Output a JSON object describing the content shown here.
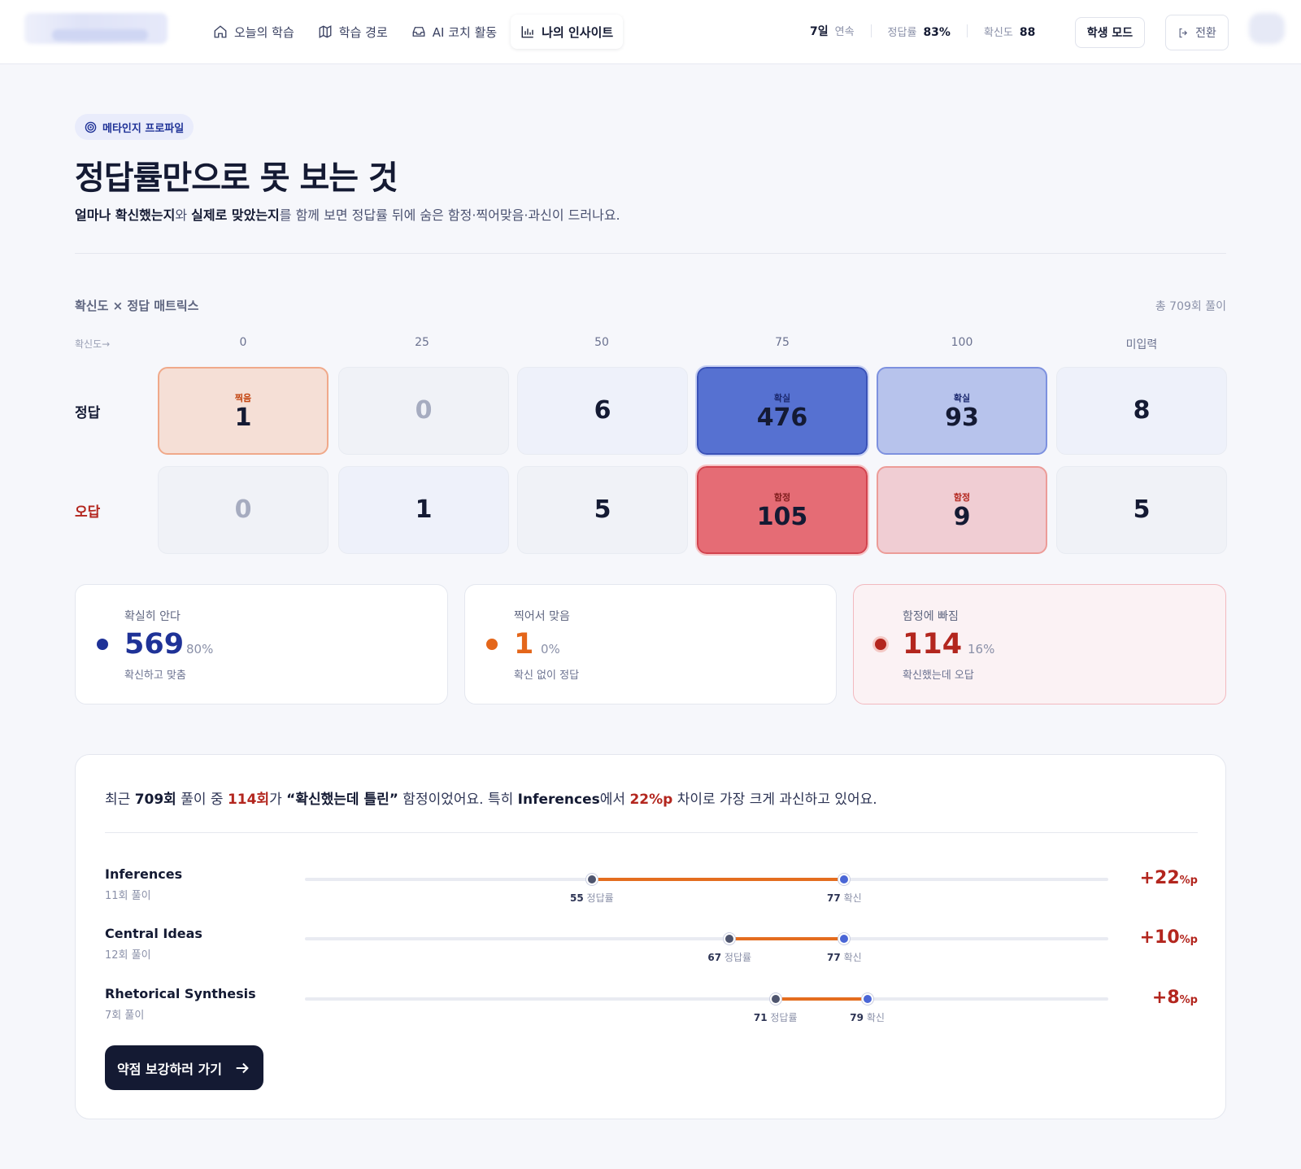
{
  "nav": {
    "items": [
      {
        "label": "오늘의 학습",
        "icon": "home-icon"
      },
      {
        "label": "학습 경로",
        "icon": "map-icon"
      },
      {
        "label": "AI 코치 활동",
        "icon": "inbox-icon"
      },
      {
        "label": "나의 인사이트",
        "icon": "bar-chart-icon",
        "active": true
      }
    ]
  },
  "stats": {
    "streak_value": "7일",
    "streak_label": "연속",
    "accuracy_label": "정답률",
    "accuracy_value": "83%",
    "confidence_label": "확신도",
    "confidence_value": "88"
  },
  "header": {
    "mode_button": "학생 모드",
    "switch_button": "전환",
    "chip": "메타인지 프로파일",
    "title": "정답률만으로 못 보는 것",
    "sub_b1": "얼마나 확신했는지",
    "sub_t1": "와 ",
    "sub_b2": "실제로 맞았는지",
    "sub_t2": "를 함께 보면 정답률 뒤에 숨은 함정·찍어맞음·과신이 드러나요."
  },
  "matrix": {
    "title": "확신도 × 정답 매트릭스",
    "total": "총 709회 풀이",
    "axis": "확신도→",
    "columns": [
      "0",
      "25",
      "50",
      "75",
      "100",
      "미입력"
    ],
    "rows": [
      {
        "label": "정답",
        "cells": [
          {
            "value": "1",
            "tag": "찍음",
            "style": "guess"
          },
          {
            "value": "0",
            "tag": "",
            "style": "zero"
          },
          {
            "value": "6",
            "tag": "",
            "style": "light"
          },
          {
            "value": "476",
            "tag": "확실",
            "style": "sure-strong"
          },
          {
            "value": "93",
            "tag": "확실",
            "style": "sure-light"
          },
          {
            "value": "8",
            "tag": "",
            "style": "light"
          }
        ]
      },
      {
        "label": "오답",
        "cells": [
          {
            "value": "0",
            "tag": "",
            "style": "zero"
          },
          {
            "value": "1",
            "tag": "",
            "style": "light"
          },
          {
            "value": "5",
            "tag": "",
            "style": "plain"
          },
          {
            "value": "105",
            "tag": "함정",
            "style": "trap-strong"
          },
          {
            "value": "9",
            "tag": "함정",
            "style": "trap-light"
          },
          {
            "value": "5",
            "tag": "",
            "style": "plain"
          }
        ]
      }
    ]
  },
  "summary": [
    {
      "label": "확실히 안다",
      "value": "569",
      "pct": "80%",
      "desc": "확신하고 맞춤",
      "color": "#1f3297"
    },
    {
      "label": "찍어서 맞음",
      "value": "1",
      "pct": "0%",
      "desc": "확신 없이 정답",
      "color": "#e4661a"
    },
    {
      "label": "함정에 빠짐",
      "value": "114",
      "pct": "16%",
      "desc": "확신했는데 오답",
      "color": "#b3261e"
    }
  ],
  "insight": {
    "t1": "최근 ",
    "b1": "709회",
    "t2": " 풀이 중 ",
    "r1": "114회",
    "t3": "가 ",
    "b2": "“확신했는데 틀린”",
    "t4": " 함정이었어요. 특히 ",
    "b3": "Inferences",
    "t5": "에서 ",
    "r2": "22%p",
    "t6": " 차이로 가장 크게 과신하고 있어요.",
    "acc_label": "정답률",
    "conf_label": "확신",
    "unit": "%p",
    "cta": "약점 보강하러 가기",
    "rows": [
      {
        "name": "Inferences",
        "count": "11회 풀이",
        "accuracy": 55,
        "confidence": 77,
        "diff": "+22"
      },
      {
        "name": "Central Ideas",
        "count": "12회 풀이",
        "accuracy": 67,
        "confidence": 77,
        "diff": "+10"
      },
      {
        "name": "Rhetorical Synthesis",
        "count": "7회 풀이",
        "accuracy": 71,
        "confidence": 79,
        "diff": "+8"
      }
    ]
  }
}
